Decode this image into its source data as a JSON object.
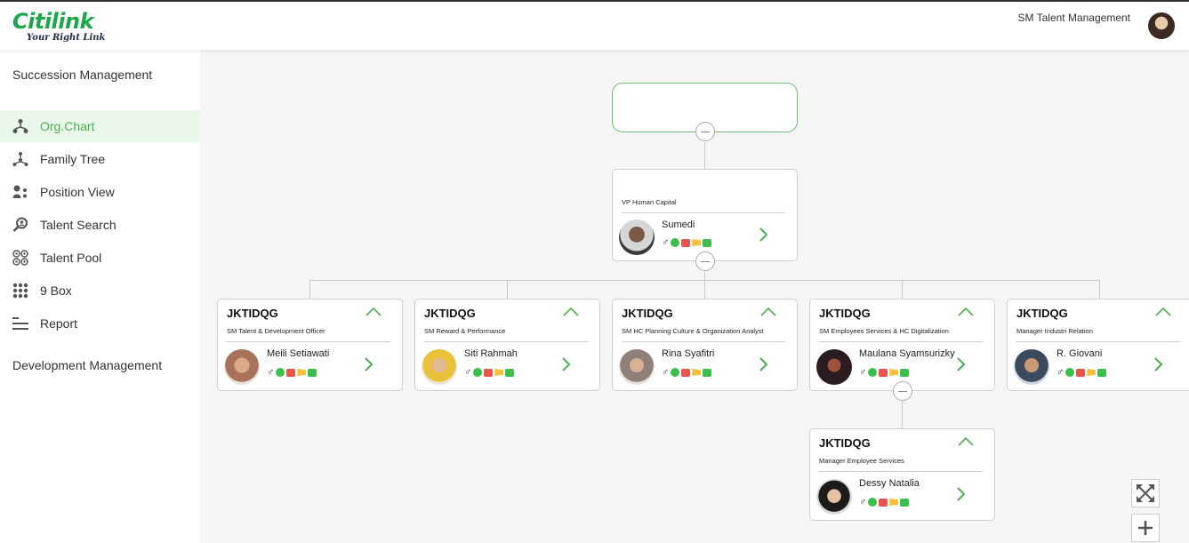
{
  "header": {
    "logo_main": "Citilink",
    "logo_tag": "Your Right Link",
    "user": "SM Talent Management"
  },
  "sidebar": {
    "section1": "Succession Management",
    "items": [
      {
        "label": "Org.Chart",
        "icon": "org-chart-icon",
        "active": true
      },
      {
        "label": "Family Tree",
        "icon": "family-tree-icon"
      },
      {
        "label": "Position View",
        "icon": "position-view-icon"
      },
      {
        "label": "Talent Search",
        "icon": "talent-search-icon"
      },
      {
        "label": "Talent Pool",
        "icon": "talent-pool-icon"
      },
      {
        "label": "9 Box",
        "icon": "nine-box-icon"
      },
      {
        "label": "Report",
        "icon": "report-icon"
      }
    ],
    "section2": "Development Management"
  },
  "orgchart": {
    "vp": {
      "title": "VP Human Capital",
      "name": "Sumedi"
    },
    "children": [
      {
        "code": "JKTIDQG",
        "title": "SM Talent & Development Officer",
        "name": "Meili Setiawati"
      },
      {
        "code": "JKTIDQG",
        "title": "SM Reward & Performance",
        "name": "Siti Rahmah"
      },
      {
        "code": "JKTIDQG",
        "title": "SM HC Planning Culture & Organization Analyst",
        "name": "Rina Syafitri"
      },
      {
        "code": "JKTIDQG",
        "title": "SM Employees Services & HC Digitalization",
        "name": "Maulana Syamsurizky"
      },
      {
        "code": "JKTIDQG",
        "title": "Manager Industri Relation",
        "name": "R. Giovani"
      }
    ],
    "grandchild": {
      "code": "JKTIDQG",
      "title": "Manager Employee Services",
      "name": "Dessy Natalia"
    }
  },
  "colors": {
    "accent": "#4caf50",
    "active_bg": "#eaf8ec",
    "brand": "#1aa84a"
  },
  "badges": {
    "gender_symbol": "♂"
  }
}
